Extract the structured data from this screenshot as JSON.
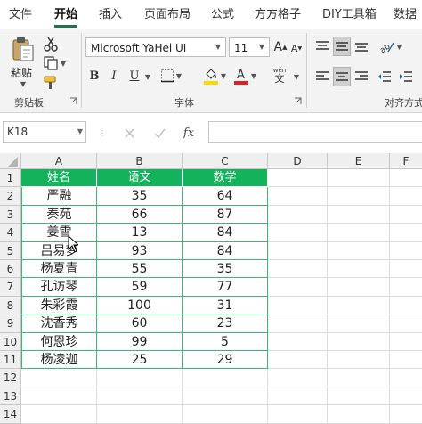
{
  "ribbon_tabs": [
    "文件",
    "开始",
    "插入",
    "页面布局",
    "公式",
    "方方格子",
    "DIY工具箱",
    "数据"
  ],
  "active_tab": "开始",
  "clipboard": {
    "paste_label": "粘贴",
    "group_label": "剪贴板"
  },
  "font": {
    "font_name": "Microsoft YaHei UI",
    "font_size": "11",
    "group_label": "字体",
    "bold": "B",
    "italic": "I",
    "underline": "U",
    "grow": "A",
    "shrink": "A",
    "phonetic_top": "wén",
    "phonetic_bottom": "文"
  },
  "alignment": {
    "group_label": "对齐方式"
  },
  "formula_bar": {
    "name_box": "K18",
    "fx_label": "fx",
    "formula": ""
  },
  "columns": [
    "A",
    "B",
    "C",
    "D",
    "E",
    "F"
  ],
  "rows": [
    "1",
    "2",
    "3",
    "4",
    "5",
    "6",
    "7",
    "8",
    "9",
    "10",
    "11",
    "12",
    "13",
    "14"
  ],
  "table": {
    "headers": [
      "姓名",
      "语文",
      "数学"
    ],
    "rows": [
      [
        "严融",
        "35",
        "64"
      ],
      [
        "秦苑",
        "66",
        "87"
      ],
      [
        "姜雪",
        "13",
        "84"
      ],
      [
        "吕易梦",
        "93",
        "84"
      ],
      [
        "杨夏青",
        "55",
        "35"
      ],
      [
        "孔访琴",
        "59",
        "77"
      ],
      [
        "朱彩霞",
        "100",
        "31"
      ],
      [
        "沈香秀",
        "60",
        "23"
      ],
      [
        "何恩珍",
        "99",
        "5"
      ],
      [
        "杨凌迦",
        "25",
        "29"
      ]
    ]
  },
  "colors": {
    "accent": "#217346",
    "header_fill": "#12b35a",
    "table_border": "#3fb96e"
  }
}
